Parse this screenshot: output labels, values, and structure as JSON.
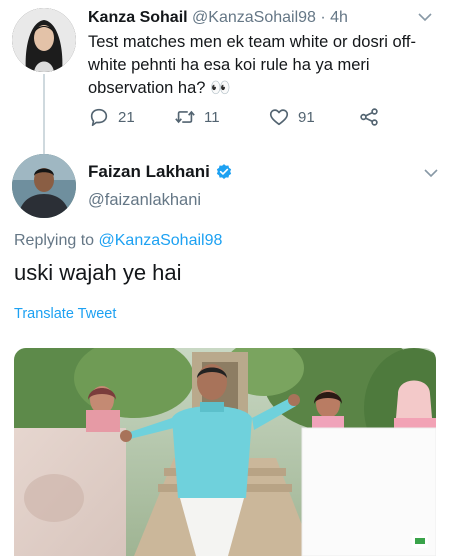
{
  "tweet_original": {
    "display_name": "Kanza Sohail",
    "handle": "@KanzaSohail98",
    "separator": "·",
    "time": "4h",
    "text": "Test matches men ek team white or dosri off-white pehnti ha esa koi rule ha ya meri observation ha? 👀",
    "actions": {
      "reply_count": "21",
      "retweet_count": "11",
      "like_count": "91"
    }
  },
  "tweet_reply": {
    "display_name": "Faizan Lakhani",
    "handle": "@faizanlakhani",
    "replying_prefix": "Replying to",
    "replying_to": "@KanzaSohail98",
    "text": "uski wajah ye hai",
    "translate_label": "Translate Tweet"
  },
  "colors": {
    "accent": "#1da1f2",
    "muted": "#657786",
    "text": "#14171a"
  }
}
